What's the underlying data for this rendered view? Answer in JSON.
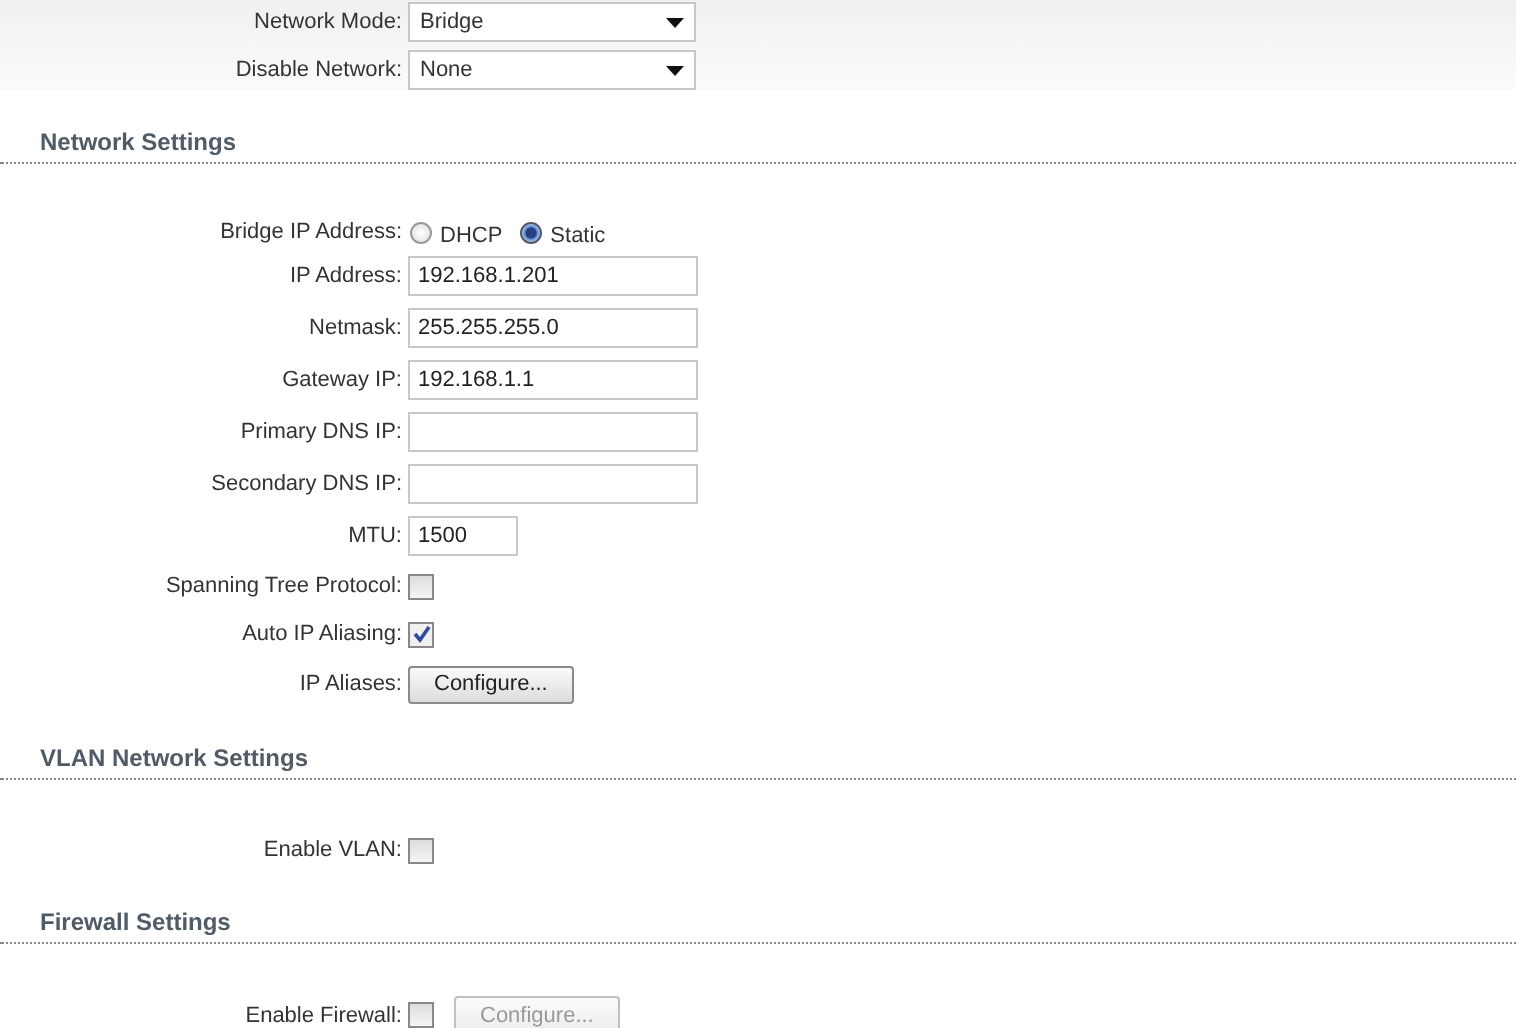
{
  "top_rows": [
    {
      "kind": "select",
      "label": "Network Mode:",
      "value": "Bridge"
    },
    {
      "kind": "select",
      "label": "Disable Network:",
      "value": "None"
    }
  ],
  "sections": [
    {
      "title": "Network Settings",
      "rows": [
        {
          "kind": "radio",
          "label": "Bridge IP Address:",
          "options": [
            {
              "label": "DHCP",
              "selected": false
            },
            {
              "label": "Static",
              "selected": true
            }
          ]
        },
        {
          "kind": "text",
          "label": "IP Address:",
          "value": "192.168.1.201"
        },
        {
          "kind": "text",
          "label": "Netmask:",
          "value": "255.255.255.0"
        },
        {
          "kind": "text",
          "label": "Gateway IP:",
          "value": "192.168.1.1"
        },
        {
          "kind": "text",
          "label": "Primary DNS IP:"
        },
        {
          "kind": "text",
          "label": "Secondary DNS IP:"
        },
        {
          "kind": "short_text",
          "label": "MTU:",
          "value": "1500"
        },
        {
          "kind": "checkbox",
          "label": "Spanning Tree Protocol:",
          "checked": false
        },
        {
          "kind": "checkbox",
          "label": "Auto IP Aliasing:",
          "checked": true
        },
        {
          "kind": "button",
          "label": "IP Aliases:",
          "button": "Configure...",
          "disabled": false
        }
      ]
    },
    {
      "title": "VLAN Network Settings",
      "rows": [
        {
          "kind": "checkbox",
          "label": "Enable VLAN:",
          "checked": false
        }
      ]
    },
    {
      "title": "Firewall Settings",
      "rows": [
        {
          "kind": "checkbox_button",
          "label": "Enable Firewall:",
          "checked": false,
          "button": "Configure...",
          "disabled": true
        }
      ]
    }
  ]
}
